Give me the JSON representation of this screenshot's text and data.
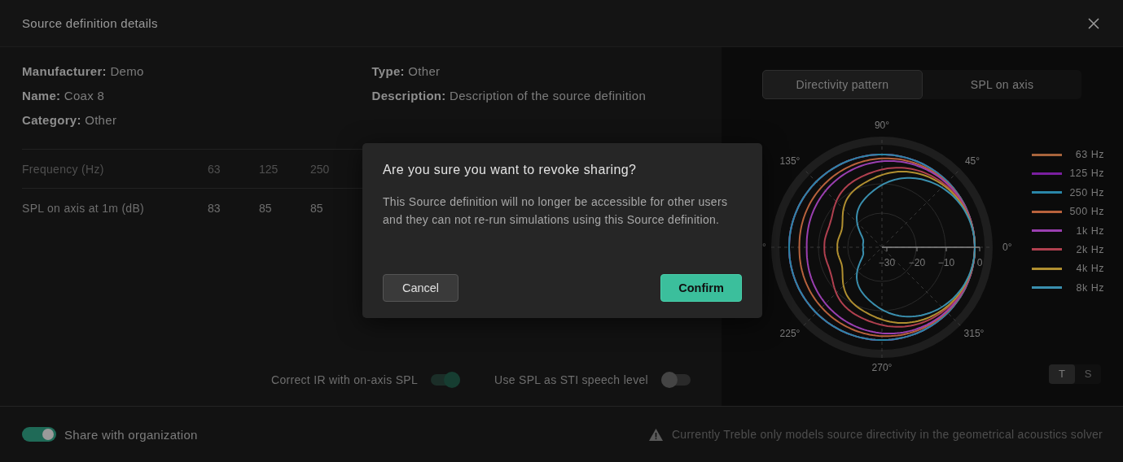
{
  "window": {
    "title": "Source definition details"
  },
  "details_left": [
    "**Manufacturer:** Demo",
    "**Name:** Coax 8",
    "**Category:** Other"
  ],
  "details_right": [
    "**Type:** Other",
    "**Description:** Description of the source definition"
  ],
  "table": {
    "rows": [
      {
        "kind": "header",
        "label": "Frequency (Hz)",
        "cells": [
          "63",
          "125",
          "250"
        ]
      },
      {
        "kind": "data",
        "label": "SPL on axis at 1m (dB)",
        "cells": [
          "83",
          "85",
          "85"
        ]
      }
    ]
  },
  "toggles": [
    {
      "label": "Correct IR with on-axis SPL",
      "on": true
    },
    {
      "label": "Use SPL as STI speech level",
      "on": false
    }
  ],
  "tabs": [
    {
      "label": "Directivity pattern",
      "selected": true
    },
    {
      "label": "SPL on axis",
      "selected": false
    }
  ],
  "plot": {
    "angle_labels": [
      "0°",
      "45°",
      "90°",
      "135°",
      "°",
      "225°",
      "270°",
      "315°"
    ],
    "radial_ticks": [
      "−30",
      "−20",
      "−10",
      "0"
    ]
  },
  "legend": [
    {
      "label": "63 Hz",
      "color": "#a8643c"
    },
    {
      "label": "125 Hz",
      "color": "#7a1fa0"
    },
    {
      "label": "250 Hz",
      "color": "#2a86a8"
    },
    {
      "label": "500 Hz",
      "color": "#b8623c"
    },
    {
      "label": "1k Hz",
      "color": "#9a3fb0"
    },
    {
      "label": "2k Hz",
      "color": "#b0404f"
    },
    {
      "label": "4k Hz",
      "color": "#b08f30"
    },
    {
      "label": "8k Hz",
      "color": "#3a8fae"
    }
  ],
  "scale_toggle": [
    {
      "label": "T",
      "selected": true
    },
    {
      "label": "S",
      "selected": false
    }
  ],
  "share": {
    "label": "Share with organization",
    "on": true
  },
  "notice": "Currently Treble only models source directivity in the geometrical acoustics solver",
  "dialog": {
    "title": "Are you sure you want to revoke sharing?",
    "body": "This Source definition will no longer be accessible for other users and they can not re-run simulations using this Source definition.",
    "buttons": [
      {
        "label": "Cancel",
        "kind": "secondary"
      },
      {
        "label": "Confirm",
        "kind": "primary"
      }
    ]
  }
}
